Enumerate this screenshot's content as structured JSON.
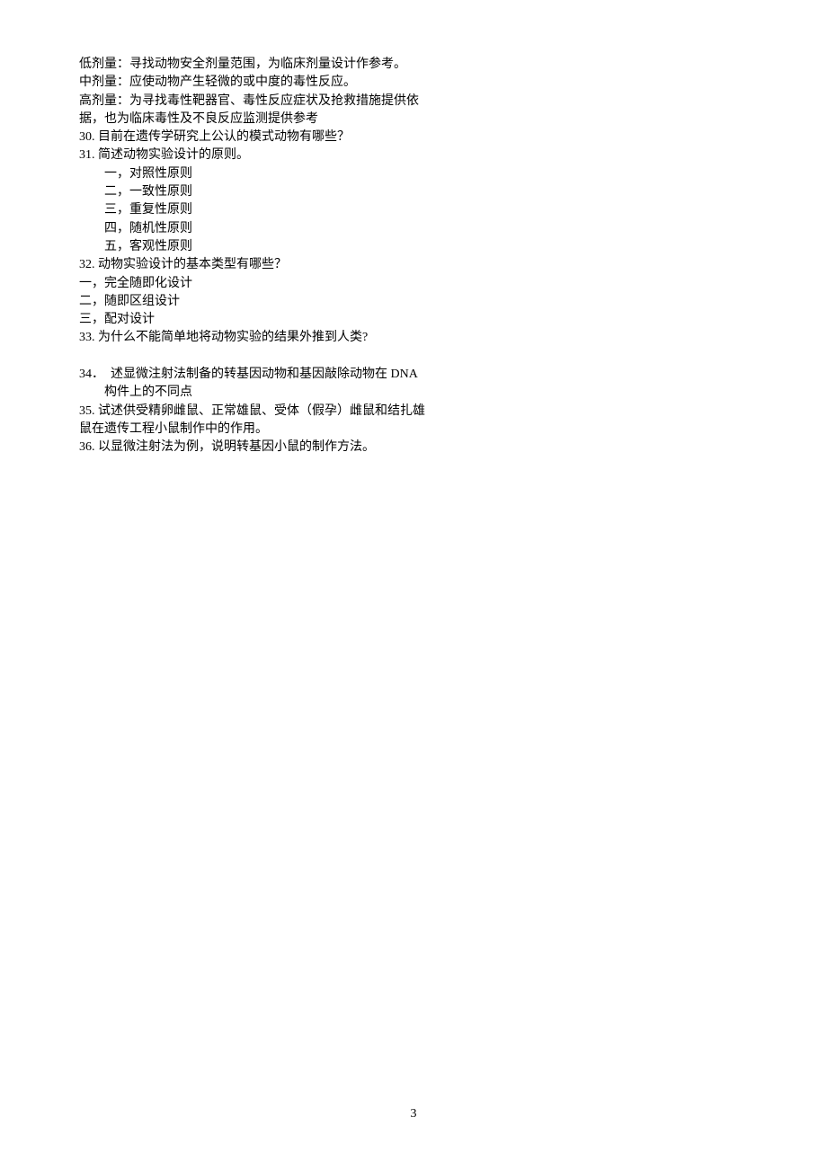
{
  "lines": {
    "l1": "低剂量：寻找动物安全剂量范围，为临床剂量设计作参考。",
    "l2": "中剂量：应使动物产生轻微的或中度的毒性反应。",
    "l3": "高剂量：为寻找毒性靶器官、毒性反应症状及抢救措施提供依",
    "l4": "据，也为临床毒性及不良反应监测提供参考",
    "l5": "30. 目前在遗传学研究上公认的模式动物有哪些？",
    "l6": "31. 简述动物实验设计的原则。",
    "l7": "一，对照性原则",
    "l8": "二，一致性原则",
    "l9": "三，重复性原则",
    "l10": "四，随机性原则",
    "l11": "五，客观性原则",
    "l12": "32. 动物实验设计的基本类型有哪些？",
    "l13": "一，完全随即化设计",
    "l14": "二，随即区组设计",
    "l15": "三，配对设计",
    "l16": "33. 为什么不能简单地将动物实验的结果外推到人类?",
    "l17": " ",
    "l18": "34．  述显微注射法制备的转基因动物和基因敲除动物在 DNA",
    "l19": "构件上的不同点",
    "l20": "35. 试述供受精卵雌鼠、正常雄鼠、受体（假孕）雌鼠和结扎雄",
    "l21": "鼠在遗传工程小鼠制作中的作用。",
    "l22": "36. 以显微注射法为例，说明转基因小鼠的制作方法。"
  },
  "pageNumber": "3"
}
